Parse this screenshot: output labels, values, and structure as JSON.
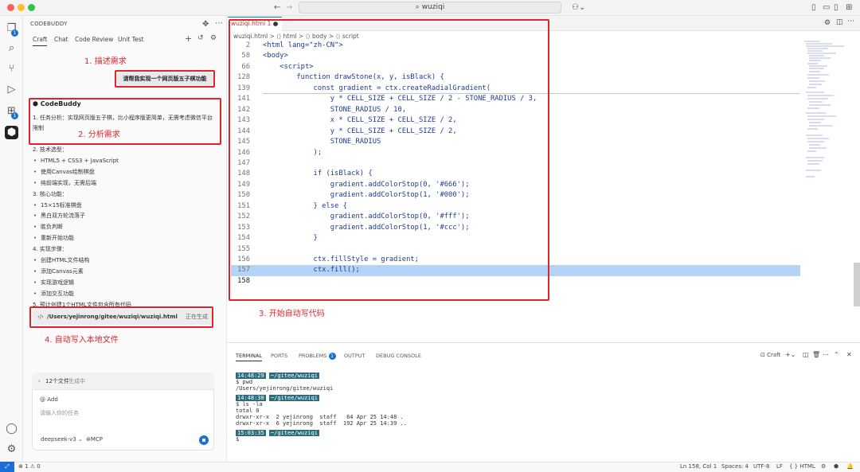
{
  "titlebar": {
    "search_text": "wuziqi",
    "nav_back": "←",
    "nav_forward": "→"
  },
  "activity": {
    "explorer_badge": "1",
    "extensions_badge": "1"
  },
  "side": {
    "title": "CODEBUDDY",
    "tabs": [
      "Craft",
      "Chat",
      "Code Review",
      "Unit Test"
    ],
    "user_message": "请帮我实现一个网页版五子棋功能",
    "ai_name": "CodeBuddy",
    "ai_lines": [
      {
        "text": "1. 任务分析：实现网页版五子棋，比小程序版更简单，无需考虑微信平台",
        "kind": "plain"
      },
      {
        "text": "限制",
        "kind": "plain"
      },
      {
        "text": "2. 技术选型：",
        "kind": "plain"
      },
      {
        "text": "HTML5 + CSS3 + JavaScript",
        "kind": "bullet"
      },
      {
        "text": "使用Canvas绘制棋盘",
        "kind": "bullet"
      },
      {
        "text": "纯前端实现，无需后端",
        "kind": "bullet"
      },
      {
        "text": "3. 核心功能：",
        "kind": "plain"
      },
      {
        "text": "15×15标准棋盘",
        "kind": "bullet"
      },
      {
        "text": "黑白双方轮流落子",
        "kind": "bullet"
      },
      {
        "text": "胜负判断",
        "kind": "bullet"
      },
      {
        "text": "重新开始功能",
        "kind": "bullet"
      },
      {
        "text": "4. 实现步骤：",
        "kind": "plain"
      },
      {
        "text": "创建HTML文件结构",
        "kind": "bullet"
      },
      {
        "text": "添加Canvas元素",
        "kind": "bullet"
      },
      {
        "text": "实现游戏逻辑",
        "kind": "bullet"
      },
      {
        "text": "添加交互功能",
        "kind": "bullet"
      },
      {
        "text": "5. 预计创建1个HTML文件包含所有代码",
        "kind": "plain"
      }
    ],
    "file_path": "/Users/yejinrong/gitee/wuziqi/wuziqi.html",
    "file_status": "正在生成",
    "composer_files": "12个文件",
    "composer_files_status": "生成中",
    "composer_add": "@ Add",
    "composer_placeholder": "请输入你的任务",
    "model": "deepseek-v3",
    "mcp": "MCP"
  },
  "annotations": {
    "a1": "1. 描述需求",
    "a2": "2. 分析需求",
    "a3": "3. 开始自动写代码",
    "a4": "4. 自动写入本地文件"
  },
  "editor": {
    "tab_label": "wuziqi.html",
    "tab_badge": "1",
    "breadcrumb": [
      "wuziqi.html",
      "html",
      "body",
      "script"
    ],
    "lines": [
      {
        "n": "2",
        "code": "<html lang=\"zh-CN\">",
        "indent": 0
      },
      {
        "n": "58",
        "code": "<body>",
        "indent": 0
      },
      {
        "n": "66",
        "code": "    <script>",
        "indent": 0
      },
      {
        "n": "128",
        "code": "        function drawStone(x, y, isBlack) {",
        "indent": 0
      },
      {
        "n": "139",
        "code": "            const gradient = ctx.createRadialGradient(",
        "indent": 0
      },
      {
        "n": "141",
        "code": "                y * CELL_SIZE + CELL_SIZE / 2 - STONE_RADIUS / 3,",
        "indent": 0
      },
      {
        "n": "142",
        "code": "                STONE_RADIUS / 10,",
        "indent": 0
      },
      {
        "n": "143",
        "code": "                x * CELL_SIZE + CELL_SIZE / 2,",
        "indent": 0
      },
      {
        "n": "144",
        "code": "                y * CELL_SIZE + CELL_SIZE / 2,",
        "indent": 0
      },
      {
        "n": "145",
        "code": "                STONE_RADIUS",
        "indent": 0
      },
      {
        "n": "146",
        "code": "            );",
        "indent": 0
      },
      {
        "n": "147",
        "code": "",
        "indent": 0
      },
      {
        "n": "148",
        "code": "            if (isBlack) {",
        "indent": 0
      },
      {
        "n": "149",
        "code": "                gradient.addColorStop(0, '#666');",
        "indent": 0
      },
      {
        "n": "150",
        "code": "                gradient.addColorStop(1, '#000');",
        "indent": 0
      },
      {
        "n": "151",
        "code": "            } else {",
        "indent": 0
      },
      {
        "n": "152",
        "code": "                gradient.addColorStop(0, '#fff');",
        "indent": 0
      },
      {
        "n": "153",
        "code": "                gradient.addColorStop(1, '#ccc');",
        "indent": 0
      },
      {
        "n": "154",
        "code": "            }",
        "indent": 0
      },
      {
        "n": "155",
        "code": "",
        "indent": 0
      },
      {
        "n": "156",
        "code": "            ctx.fillStyle = gradient;",
        "indent": 0
      },
      {
        "n": "157",
        "code": "            ctx.fill();",
        "indent": 0
      },
      {
        "n": "158",
        "code": "",
        "indent": 0
      }
    ]
  },
  "panel": {
    "tabs": [
      "TERMINAL",
      "PORTS",
      "PROBLEMS",
      "OUTPUT",
      "DEBUG CONSOLE"
    ],
    "problems_badge": "1",
    "shell_label": "Craft",
    "terminal": [
      {
        "time": "14:48:29",
        "dir": "~/gitee/wuziqi"
      },
      {
        "cmd": "$ pwd"
      },
      {
        "out": "/Users/yejinrong/gitee/wuziqi"
      },
      {
        "time": "14:48:30",
        "dir": "~/gitee/wuziqi"
      },
      {
        "cmd": "$ ls -la"
      },
      {
        "out": "total 0"
      },
      {
        "out": "drwxr-xr-x  2 yejinrong  staff   64 Apr 25 14:48 ."
      },
      {
        "out": "drwxr-xr-x  6 yejinrong  staff  192 Apr 25 14:39 .."
      },
      {
        "time": "15:03:35",
        "dir": "~/gitee/wuziqi"
      },
      {
        "cmd": "$ "
      }
    ]
  },
  "status": {
    "problems": "⊗ 1 ⚠ 0",
    "position": "Ln 158, Col 1",
    "spaces": "Spaces: 4",
    "encoding": "UTF-8",
    "eol": "LF",
    "language": "{ } HTML"
  }
}
